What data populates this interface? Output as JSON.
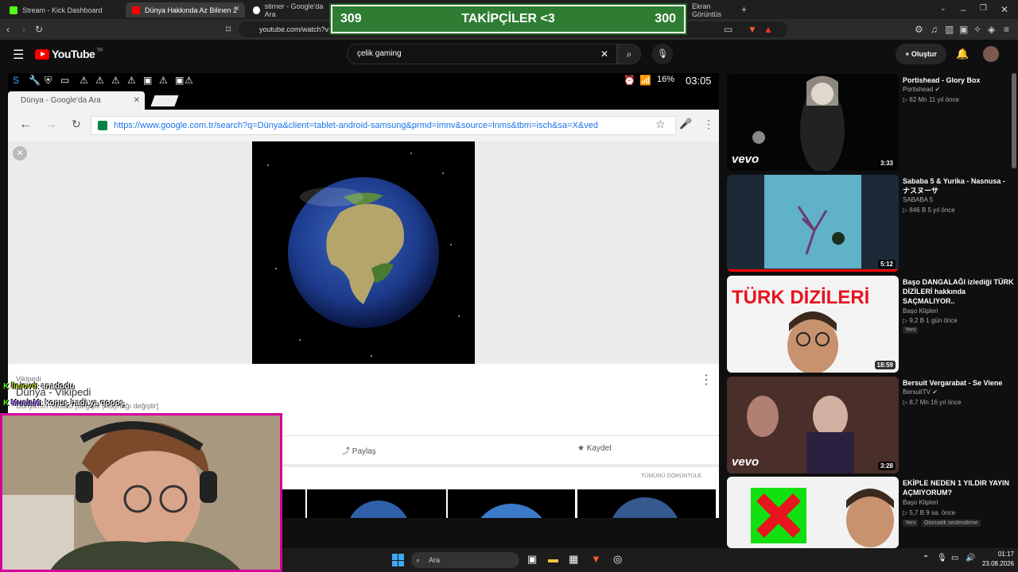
{
  "browser": {
    "tabs": [
      {
        "label": "Stream - Kick Dashboard",
        "active": false
      },
      {
        "label": "Dünya Hakkında Az Bilinen 2",
        "active": true
      },
      {
        "label": "stirner - Google'da Ara",
        "active": false
      },
      {
        "label": "Ekran Görüntüs",
        "active": false
      }
    ],
    "url": "youtube.com/watch?v="
  },
  "overlay": {
    "left_count": "309",
    "label": "TAKİPÇİLER <3",
    "right_count": "300"
  },
  "youtube": {
    "logo": "YouTube",
    "region": "TR",
    "search_value": "çelik gaming",
    "create_label": "Oluştur"
  },
  "video": {
    "android_time": "03:05",
    "android_battery": "16%",
    "chrome_tab": "Dünya - Google'da Ara",
    "chrome_url": "https://www.google.com.tr/search?q=Dünya&client=tablet-android-samsung&prmd=imnv&source=lnms&tbm=isch&sa=X&ved",
    "wiki_source": "Vikipedi",
    "wiki_title": "Dünya - Vikipedi",
    "wiki_sub": "Dünya'nın haritası [değiştir | kaynağı değiştir]",
    "share_label": "Paylaş",
    "save_label": "Kaydet",
    "view_all": "TÜMÜNÜ GÖRÜNTÜLE"
  },
  "chat": [
    {
      "user": "lleiovd",
      "message": ": anadodu"
    },
    {
      "user": "MuslaM",
      "message": ": konuş hadi ya qoooş"
    }
  ],
  "recommendations": [
    {
      "title": "Portishead - Glory Box",
      "channel": "Portishead",
      "meta": "62 Mn   11 yıl önce",
      "duration": "3:33",
      "vevo": true
    },
    {
      "title": "Sababa 5 & Yurika - Nasnusa - ナスヌーサ",
      "channel": "SABABA 5",
      "meta": "846 B   5 yıl önce",
      "duration": "5:12",
      "vevo": false
    },
    {
      "title": "Başo DANGALAĞI izlediği TÜRK DİZİLERİ hakkında SAÇMALIYOR..",
      "channel": "Başo Klipleri",
      "meta": "9,2 B   1 gün önce",
      "duration": "18:59",
      "badge": "Yeni",
      "thumb_text": "TÜRK DİZİLERİ",
      "vevo": false
    },
    {
      "title": "Bersuit Vergarabat - Se Viene",
      "channel": "BersuitTV",
      "meta": "8,7 Mn   16 yıl önce",
      "duration": "3:28",
      "vevo": true
    },
    {
      "title": "EKİPLE NEDEN 1 YILDIR YAYIN AÇMIYORUM?",
      "channel": "Başo Klipleri",
      "meta": "5,7 B   9 sa. önce",
      "duration": "",
      "badge": "Yeni",
      "badge2": "Otomatik seslendirme",
      "vevo": false
    }
  ],
  "taskbar": {
    "search_placeholder": "Ara",
    "time": "01:17",
    "date": "23.08.2026"
  }
}
